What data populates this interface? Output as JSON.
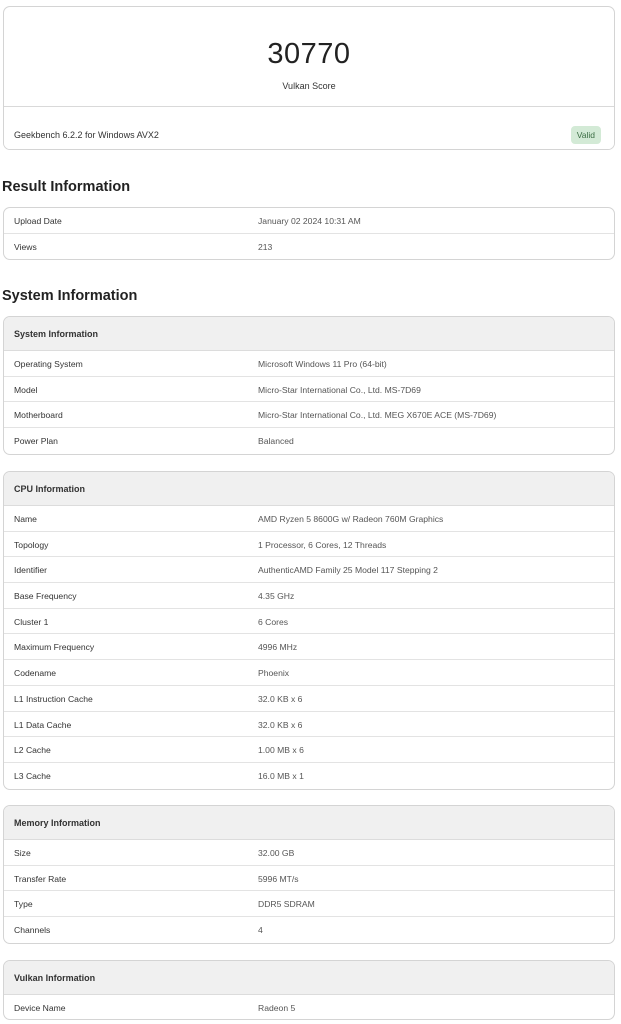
{
  "score": {
    "value": "30770",
    "label": "Vulkan Score",
    "benchmark": "Geekbench 6.2.2 for Windows AVX2",
    "status": "Valid"
  },
  "result_information": {
    "title": "Result Information",
    "rows": [
      {
        "key": "Upload Date",
        "value": "January 02 2024 10:31 AM"
      },
      {
        "key": "Views",
        "value": "213"
      }
    ]
  },
  "system_information": {
    "title": "System Information",
    "system": {
      "header": "System Information",
      "rows": [
        {
          "key": "Operating System",
          "value": "Microsoft Windows 11 Pro (64-bit)"
        },
        {
          "key": "Model",
          "value": "Micro-Star International Co., Ltd. MS-7D69"
        },
        {
          "key": "Motherboard",
          "value": "Micro-Star International Co., Ltd. MEG X670E ACE (MS-7D69)"
        },
        {
          "key": "Power Plan",
          "value": "Balanced"
        }
      ]
    },
    "cpu": {
      "header": "CPU Information",
      "rows": [
        {
          "key": "Name",
          "value": "AMD Ryzen 5 8600G w/ Radeon 760M Graphics"
        },
        {
          "key": "Topology",
          "value": "1 Processor, 6 Cores, 12 Threads"
        },
        {
          "key": "Identifier",
          "value": "AuthenticAMD Family 25 Model 117 Stepping 2"
        },
        {
          "key": "Base Frequency",
          "value": "4.35 GHz"
        },
        {
          "key": "Cluster 1",
          "value": "6 Cores"
        },
        {
          "key": "Maximum Frequency",
          "value": "4996 MHz"
        },
        {
          "key": "Codename",
          "value": "Phoenix"
        },
        {
          "key": "L1 Instruction Cache",
          "value": "32.0 KB x 6"
        },
        {
          "key": "L1 Data Cache",
          "value": "32.0 KB x 6"
        },
        {
          "key": "L2 Cache",
          "value": "1.00 MB x 6"
        },
        {
          "key": "L3 Cache",
          "value": "16.0 MB x 1"
        }
      ]
    },
    "memory": {
      "header": "Memory Information",
      "rows": [
        {
          "key": "Size",
          "value": "32.00 GB"
        },
        {
          "key": "Transfer Rate",
          "value": "5996 MT/s"
        },
        {
          "key": "Type",
          "value": "DDR5 SDRAM"
        },
        {
          "key": "Channels",
          "value": "4"
        }
      ]
    },
    "vulkan": {
      "header": "Vulkan Information",
      "rows": [
        {
          "key": "Device Name",
          "value": "Radeon 5"
        }
      ]
    }
  }
}
